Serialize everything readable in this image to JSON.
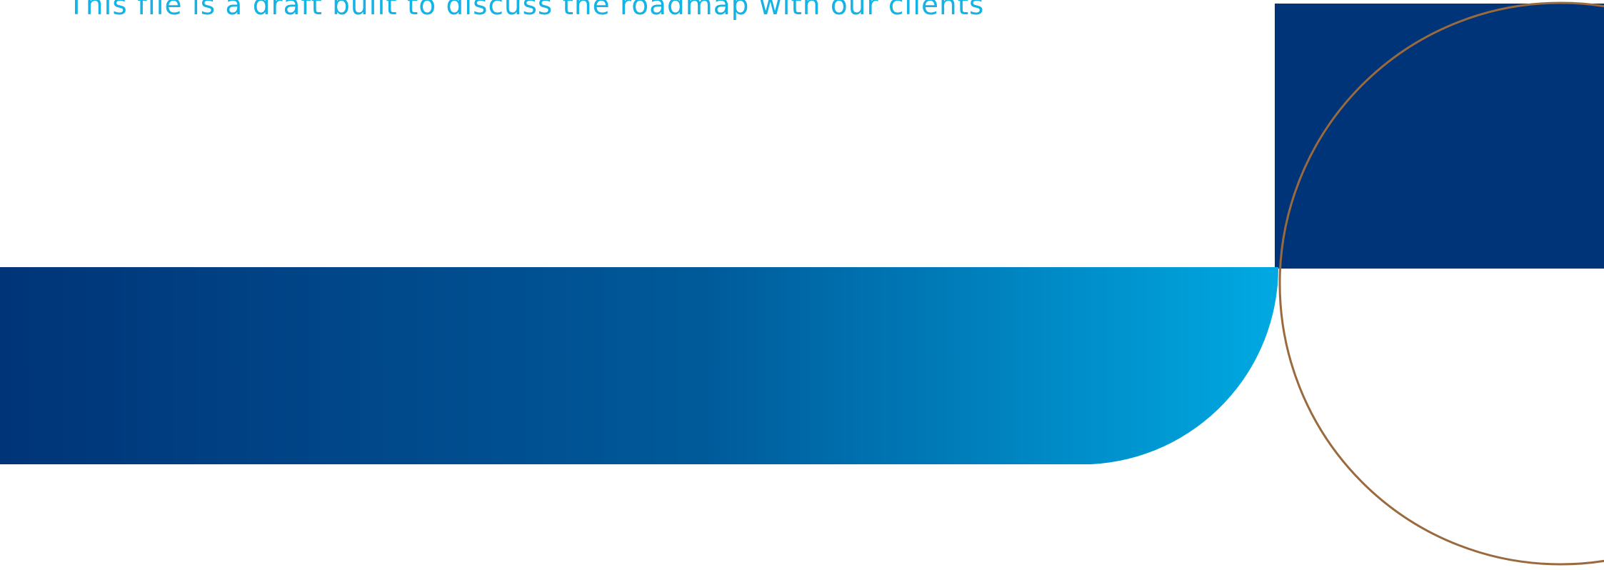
{
  "slide": {
    "subtitle": "This file is a draft built to discuss the roadmap with our clients"
  },
  "colors": {
    "navy": "#003478",
    "gradient_start": "#003478",
    "gradient_mid": "#005a9a",
    "gradient_end": "#00a9e2",
    "text_accent": "#14b3e6",
    "ring_stroke": "#9a6a3e",
    "background": "#ffffff"
  }
}
